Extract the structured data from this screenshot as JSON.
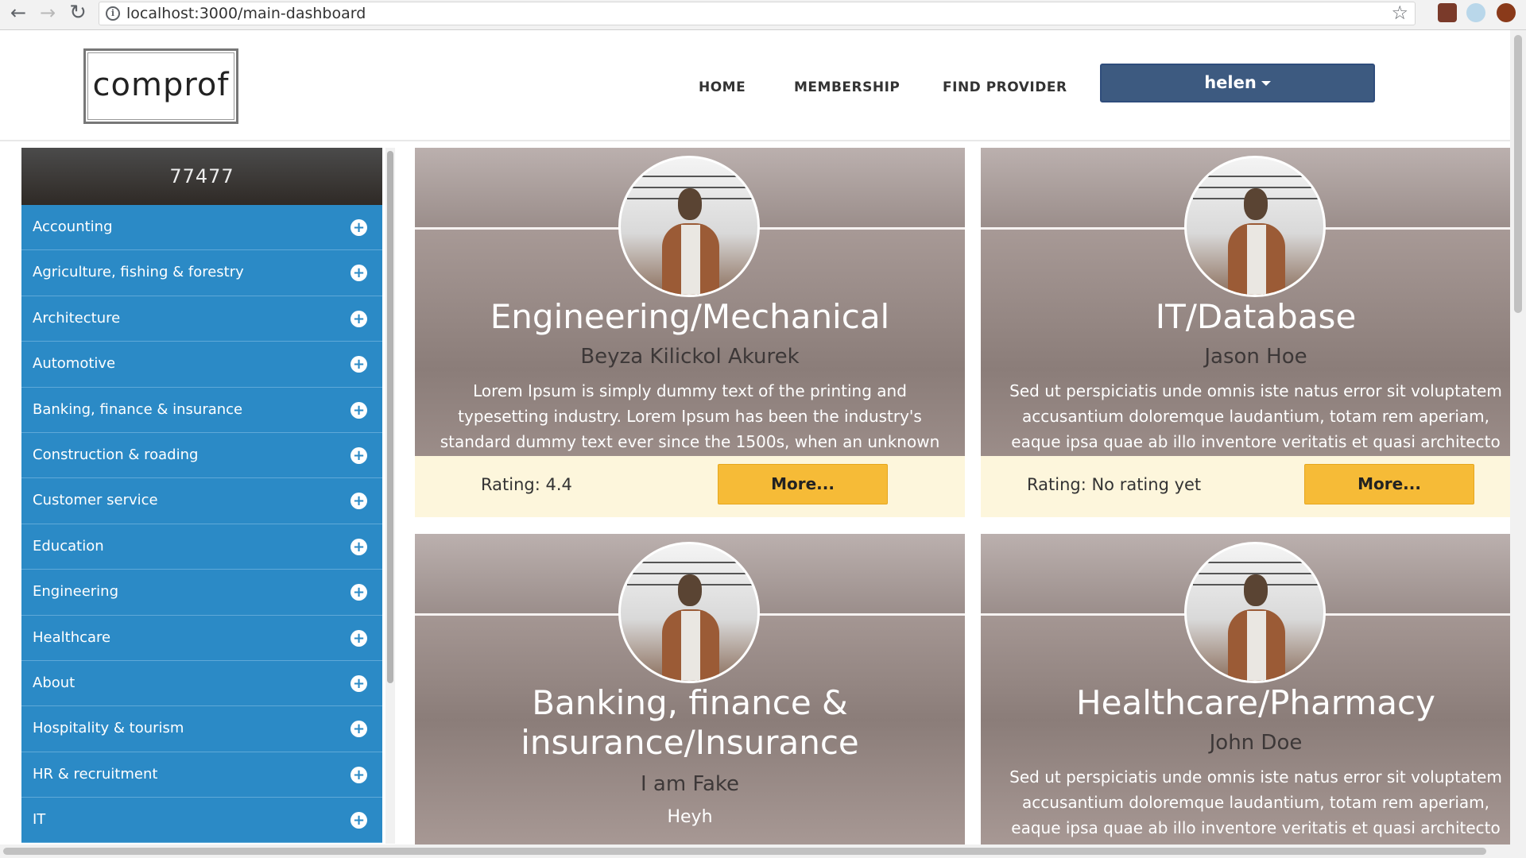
{
  "browser": {
    "url": "localhost:3000/main-dashboard"
  },
  "header": {
    "logo_text": "comprof",
    "nav": {
      "home": "HOME",
      "membership": "MEMBERSHIP",
      "find_provider": "FIND PROVIDER"
    },
    "user_label": "helen"
  },
  "sidebar": {
    "heading": "77477",
    "categories": [
      "Accounting",
      "Agriculture, fishing & forestry",
      "Architecture",
      "Automotive",
      "Banking, finance & insurance",
      "Construction & roading",
      "Customer service",
      "Education",
      "Engineering",
      "Healthcare",
      "About",
      "Hospitality & tourism",
      "HR & recruitment",
      "IT"
    ]
  },
  "cards": [
    {
      "title": "Engineering/Mechanical",
      "name": "Beyza Kilickol Akurek",
      "desc": [
        "Lorem Ipsum is simply dummy text of the printing and",
        "typesetting industry. Lorem Ipsum has been the industry's",
        "standard dummy text ever since the 1500s, when an unknown"
      ],
      "rating": "Rating: 4.4",
      "more": "More..."
    },
    {
      "title": "IT/Database",
      "name": "Jason Hoe",
      "desc": [
        "Sed ut perspiciatis unde omnis iste natus error sit voluptatem",
        "accusantium doloremque laudantium, totam rem aperiam,",
        "eaque ipsa quae ab illo inventore veritatis et quasi architecto"
      ],
      "rating": "Rating: No rating yet",
      "more": "More..."
    },
    {
      "title_line1": "Banking, finance &",
      "title_line2": "insurance/Insurance",
      "name": "I am Fake",
      "subtext": "Heyh"
    },
    {
      "title": "Healthcare/Pharmacy",
      "name": "John Doe",
      "desc": [
        "Sed ut perspiciatis unde omnis iste natus error sit voluptatem",
        "accusantium doloremque laudantium, totam rem aperiam,",
        "eaque ipsa quae ab illo inventore veritatis et quasi architecto"
      ]
    }
  ]
}
